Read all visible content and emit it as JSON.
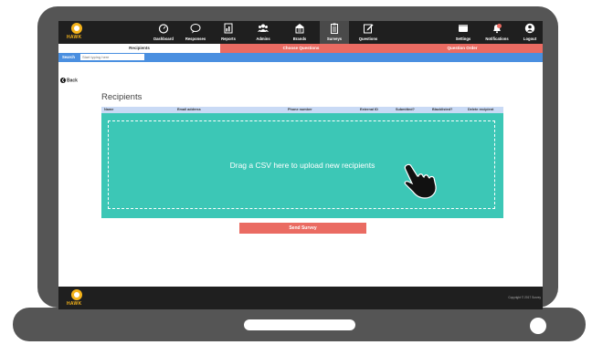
{
  "app": {
    "logo_text": "HAWK"
  },
  "nav": {
    "dashboard": "Dashboard",
    "responses": "Responses",
    "reports": "Reports",
    "admins": "Admins",
    "brands": "Brands",
    "surveys": "Surveys",
    "questions": "Questions",
    "settings": "Settings",
    "notifications": "Notifications",
    "logout": "Logout"
  },
  "tabs": {
    "recipients": "Recipients",
    "choose_questions": "Choose Questions",
    "question_order": "Question Order"
  },
  "search": {
    "label": "Search",
    "placeholder": "Start typing here"
  },
  "back_label": "Back",
  "page_title": "Recipients",
  "table": {
    "columns": [
      "Name",
      "Email address",
      "Phone number",
      "External ID",
      "Submitted?",
      "Blacklisted?",
      "Delete recipient"
    ]
  },
  "dropzone_text": "Drag a CSV here to upload new recipients",
  "send_button": "Send Survey",
  "footer": {
    "logo_text": "HAWK",
    "copyright": "Copyright © 2017 Survey"
  },
  "colors": {
    "accent_red": "#ea6b62",
    "search_blue": "#4a8fe0",
    "dropzone_teal": "#3cc7b6",
    "header_dark": "#1f1f1f",
    "logo_gold": "#f5b31a"
  }
}
